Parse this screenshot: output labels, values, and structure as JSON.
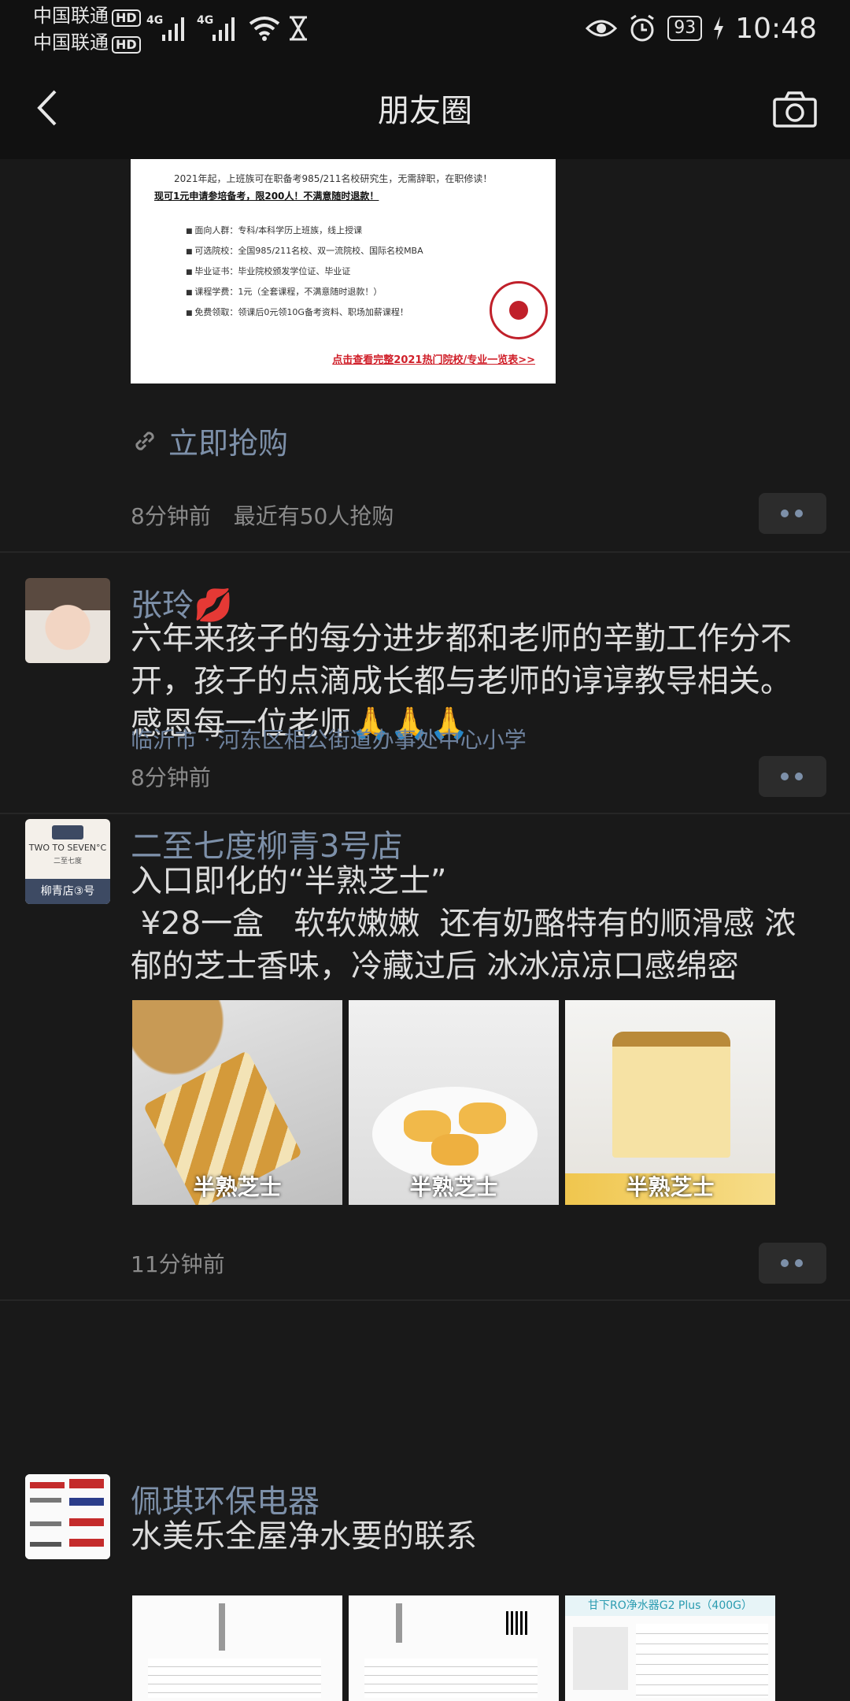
{
  "status_bar": {
    "carrier_1": "中国联通",
    "carrier_2": "中国联通",
    "hd_1": "HD",
    "hd_2": "HD",
    "net_1": "4G",
    "net_2": "4G",
    "battery": "93",
    "time": "10:48"
  },
  "nav": {
    "title": "朋友圈"
  },
  "ad_post": {
    "image_line_1": "2021年起，上班族可在职备考985/211名校研究生，无需辞职，在职修读！",
    "image_line_2": "现可1元申请参培备考，限200人！不满意随时退款！",
    "image_items": [
      "面向人群：专科/本科学历上班族，线上授课",
      "可选院校：全国985/211名校、双一流院校、国际名校MBA",
      "毕业证书：毕业院校颁发学位证、毕业证",
      "课程学费：1元（全套课程，不满意随时退款！）",
      "免费领取：领课后0元领10G备考资料、职场加薪课程！"
    ],
    "image_cta": "点击查看完整2021热门院校/专业一览表>>",
    "link_label": "立即抢购",
    "time": "8分钟前",
    "extra": "最近有50人抢购"
  },
  "posts": [
    {
      "name": "张玲💋",
      "text": "六年来孩子的每分进步都和老师的辛勤工作分不开，孩子的点滴成长都与老师的谆谆教导相关。感恩每一位老师🙏🙏🙏",
      "location": "临沂市 · 河东区相公街道办事处中心小学",
      "time": "8分钟前"
    },
    {
      "name": "二至七度柳青3号店",
      "text": "入口即化的“半熟芝士”\n ¥28一盒   软软嫩嫩  还有奶酪特有的顺滑感 浓郁的芝士香味，冷藏过后 冰冰凉凉口感绵密",
      "avatar_brand": "TWO TO SEVEN°C",
      "avatar_sub": "二至七度",
      "avatar_store": "柳青店③号",
      "thumb_captions": [
        "半熟芝士",
        "半熟芝士",
        "半熟芝士"
      ],
      "time": "11分钟前"
    },
    {
      "name": "佩琪环保电器",
      "text": "水美乐全屋净水要的联系",
      "thumb_caption_3": "甘下RO净水器G2 Plus（400G）"
    }
  ],
  "colors": {
    "background": "#191919",
    "bar": "#111111",
    "link": "#7d90a9",
    "text": "#dcdcdc",
    "muted": "#8a8a8a"
  }
}
